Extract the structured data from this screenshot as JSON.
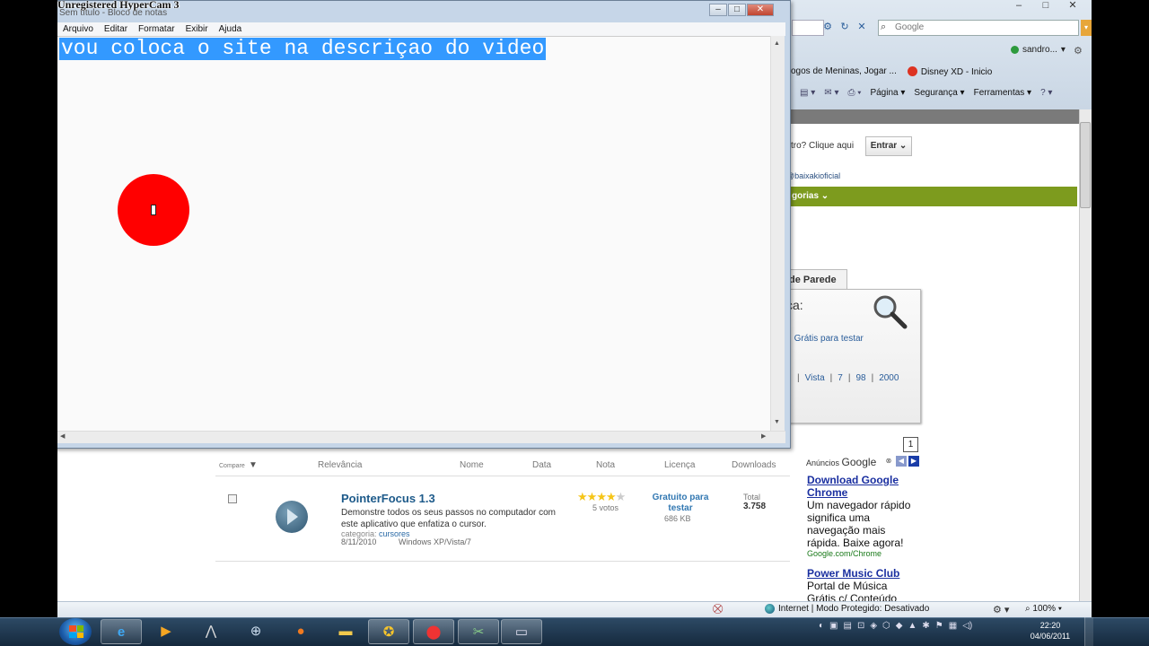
{
  "watermark": "Unregistered HyperCam 3",
  "notepad": {
    "title": "Sem título - Bloco de notas",
    "menu": [
      "Arquivo",
      "Editar",
      "Formatar",
      "Exibir",
      "Ajuda"
    ],
    "text": "vou coloca o site na descriçao do video"
  },
  "ie": {
    "search_placeholder": "Google",
    "user": "sandro...",
    "favorites": [
      "Jogos de Meninas, Jogar ...",
      "Disney XD - Inicio"
    ],
    "commands": [
      "Página",
      "Segurança",
      "Ferramentas"
    ],
    "status_zone": "Internet | Modo Protegido: Desativado",
    "zoom": "100%"
  },
  "site": {
    "login_prompt": "stro? Clique aqui",
    "login_button": "Entrar",
    "twitter": "@baixakioficial",
    "categories": "gorias",
    "tab": "de Parede",
    "box_title": "ca:",
    "filter_free": "Grátis para testar",
    "os_filters": [
      "Vista",
      "7",
      "98",
      "2000"
    ],
    "page_number": "1",
    "list_headers": {
      "compare": "Compare",
      "relevance": "Relevância",
      "name": "Nome",
      "date": "Data",
      "rating": "Nota",
      "license": "Licença",
      "downloads": "Downloads"
    },
    "item": {
      "title": "PointerFocus 1.3",
      "description": "Demonstre todos os seus passos no computador com este aplicativo que enfatiza o cursor.",
      "category_label": "categoria:",
      "category": "cursores",
      "date": "8/11/2010",
      "os": "Windows XP/Vista/7",
      "rating": 4,
      "rating_max": 5,
      "votes": "5 votos",
      "license": "Gratuito para testar",
      "size": "686 KB",
      "total_label": "Total",
      "total": "3.758"
    },
    "ads": {
      "label_small": "Anúncios",
      "label_big": "Google",
      "items": [
        {
          "title": "Download Google Chrome",
          "text": "Um navegador rápido significa uma navegação mais rápida. Baixe agora!",
          "url": "Google.com/Chrome"
        },
        {
          "title": "Power Music Club",
          "text": "Portal de Música Grátis c/ Conteúdo",
          "url": ""
        }
      ]
    }
  },
  "taskbar": {
    "time": "22:20",
    "date": "04/06/2011"
  }
}
